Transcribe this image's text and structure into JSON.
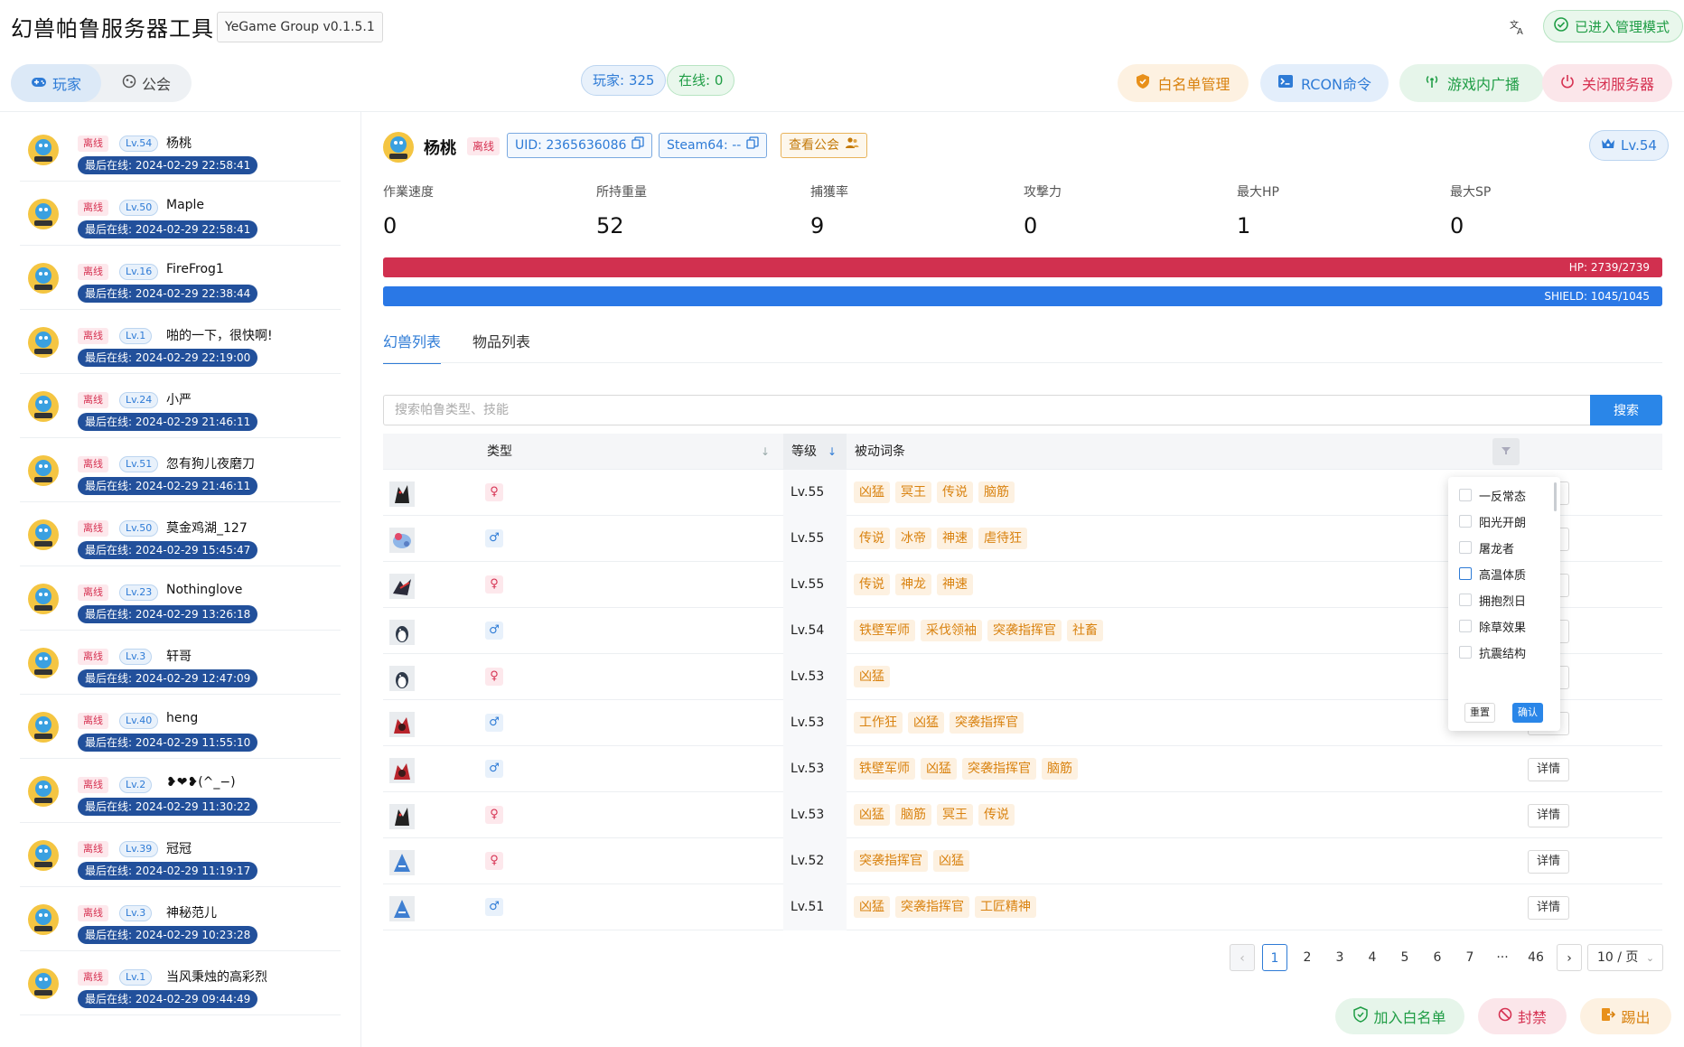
{
  "app": {
    "title": "幻兽帕鲁服务器工具",
    "version": "YeGame Group v0.1.5.1"
  },
  "header": {
    "lang_icon": "translate-icon",
    "admin_mode": "已进入管理模式",
    "tab_players": "玩家",
    "tab_guilds": "公会",
    "players_count": "玩家: 325",
    "online_count": "在线: 0",
    "btn_whitelist": "白名单管理",
    "btn_rcon": "RCON命令",
    "btn_broadcast": "游戏内广播",
    "btn_shutdown": "关闭服务器"
  },
  "colors": {
    "accent": "#2e7bd6",
    "hp": "#d1304f",
    "shield": "#2a78e6",
    "offline": "#d63252",
    "lastseen_bg": "#22509b"
  },
  "players": [
    {
      "status": "离线",
      "level": "Lv.54",
      "name": "杨桃",
      "last_online": "最后在线: 2024-02-29 22:58:41"
    },
    {
      "status": "离线",
      "level": "Lv.50",
      "name": "Maple",
      "last_online": "最后在线: 2024-02-29 22:58:41"
    },
    {
      "status": "离线",
      "level": "Lv.16",
      "name": "FireFrog1",
      "last_online": "最后在线: 2024-02-29 22:38:44"
    },
    {
      "status": "离线",
      "level": "Lv.1",
      "name": "啪的一下，很快啊!",
      "last_online": "最后在线: 2024-02-29 22:19:00"
    },
    {
      "status": "离线",
      "level": "Lv.24",
      "name": "小严",
      "last_online": "最后在线: 2024-02-29 21:46:11"
    },
    {
      "status": "离线",
      "level": "Lv.51",
      "name": "忽有狗儿夜磨刀",
      "last_online": "最后在线: 2024-02-29 21:46:11"
    },
    {
      "status": "离线",
      "level": "Lv.50",
      "name": "莫金鸡湖_127",
      "last_online": "最后在线: 2024-02-29 15:45:47"
    },
    {
      "status": "离线",
      "level": "Lv.23",
      "name": "Nothinglove",
      "last_online": "最后在线: 2024-02-29 13:26:18"
    },
    {
      "status": "离线",
      "level": "Lv.3",
      "name": "轩哥",
      "last_online": "最后在线: 2024-02-29 12:47:09"
    },
    {
      "status": "离线",
      "level": "Lv.40",
      "name": "heng",
      "last_online": "最后在线: 2024-02-29 11:55:10"
    },
    {
      "status": "离线",
      "level": "Lv.2",
      "name": "❥❤❥(^_−)",
      "last_online": "最后在线: 2024-02-29 11:30:22"
    },
    {
      "status": "离线",
      "level": "Lv.39",
      "name": "冠冠",
      "last_online": "最后在线: 2024-02-29 11:19:17"
    },
    {
      "status": "离线",
      "level": "Lv.3",
      "name": "神秘范儿",
      "last_online": "最后在线: 2024-02-29 10:23:28"
    },
    {
      "status": "离线",
      "level": "Lv.1",
      "name": "当风秉烛的高彩烈",
      "last_online": "最后在线: 2024-02-29 09:44:49"
    }
  ],
  "detail": {
    "name": "杨桃",
    "status": "离线",
    "uid": "UID: 2365636086",
    "steam": "Steam64: --",
    "view_guild": "查看公会",
    "level": "Lv.54",
    "stats": [
      {
        "label": "作業速度",
        "value": "0"
      },
      {
        "label": "所持重量",
        "value": "52"
      },
      {
        "label": "捕獲率",
        "value": "9"
      },
      {
        "label": "攻撃力",
        "value": "0"
      },
      {
        "label": "最大HP",
        "value": "1"
      },
      {
        "label": "最大SP",
        "value": "0"
      }
    ],
    "hp_text": "HP: 2739/2739",
    "hp_fraction": 1.0,
    "shield_text": "SHIELD: 1045/1045",
    "shield_fraction": 1.0
  },
  "subtabs": {
    "pals": "幻兽列表",
    "items": "物品列表"
  },
  "search": {
    "placeholder": "搜索帕鲁类型、技能",
    "button": "搜索"
  },
  "table": {
    "col_type": "类型",
    "col_level": "等级",
    "col_passive": "被动词条",
    "detail_label": "详情",
    "rows": [
      {
        "img": "dark-pal-icon",
        "gender": "♀",
        "level": "Lv.55",
        "skills": [
          "凶猛",
          "冥王",
          "传说",
          "脑筋"
        ]
      },
      {
        "img": "ice-pal-icon",
        "gender": "♂",
        "level": "Lv.55",
        "skills": [
          "传说",
          "冰帝",
          "神速",
          "虐待狂"
        ]
      },
      {
        "img": "dragon-pal-icon",
        "gender": "♀",
        "level": "Lv.55",
        "skills": [
          "传说",
          "神龙",
          "神速"
        ]
      },
      {
        "img": "penguin-pal-icon",
        "gender": "♂",
        "level": "Lv.54",
        "skills": [
          "铁壁军师",
          "采伐领袖",
          "突袭指挥官",
          "社畜"
        ]
      },
      {
        "img": "penguin-pal-icon",
        "gender": "♀",
        "level": "Lv.53",
        "skills": [
          "凶猛"
        ]
      },
      {
        "img": "fire-pal-icon",
        "gender": "♂",
        "level": "Lv.53",
        "skills": [
          "工作狂",
          "凶猛",
          "突袭指挥官"
        ]
      },
      {
        "img": "fire-pal-icon",
        "gender": "♂",
        "level": "Lv.53",
        "skills": [
          "铁壁军师",
          "凶猛",
          "突袭指挥官",
          "脑筋"
        ]
      },
      {
        "img": "dark-pal-icon",
        "gender": "♀",
        "level": "Lv.53",
        "skills": [
          "凶猛",
          "脑筋",
          "冥王",
          "传说"
        ]
      },
      {
        "img": "blue-pal-icon",
        "gender": "♀",
        "level": "Lv.52",
        "skills": [
          "突袭指挥官",
          "凶猛"
        ]
      },
      {
        "img": "blue-pal-icon",
        "gender": "♂",
        "level": "Lv.51",
        "skills": [
          "凶猛",
          "突袭指挥官",
          "工匠精神"
        ]
      }
    ]
  },
  "filter": {
    "options": [
      "一反常态",
      "阳光开朗",
      "屠龙者",
      "高温体质",
      "拥抱烈日",
      "除草效果",
      "抗震结构"
    ],
    "reset": "重置",
    "confirm": "确认"
  },
  "pagination": {
    "pages": [
      "1",
      "2",
      "3",
      "4",
      "5",
      "6",
      "7",
      "···",
      "46"
    ],
    "current": "1",
    "page_size": "10 / 页"
  },
  "footer": {
    "add_whitelist": "加入白名单",
    "ban": "封禁",
    "kick": "踢出"
  }
}
